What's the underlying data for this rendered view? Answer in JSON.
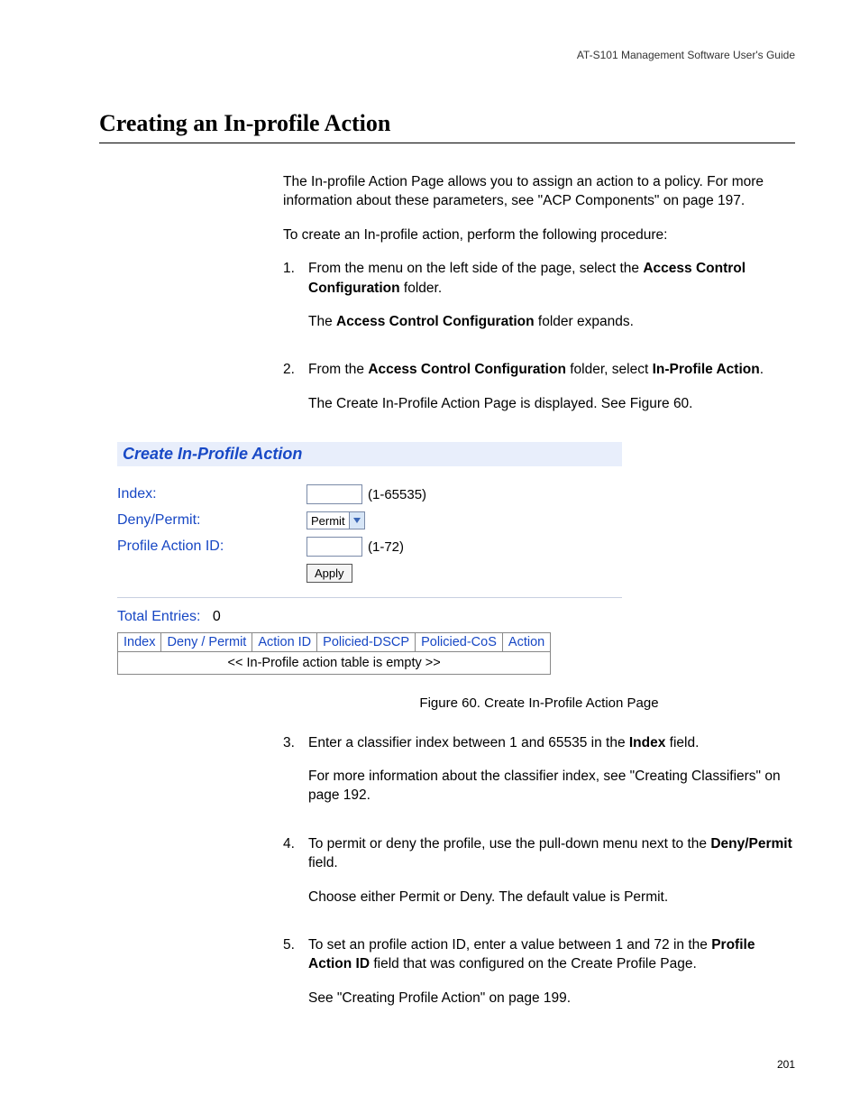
{
  "running_header": "AT-S101 Management Software User's Guide",
  "page_title": "Creating an In-profile Action",
  "intro_paragraph_parts": {
    "p1": "The In-profile Action Page allows you to assign an action to a policy. For more information about these parameters, see \"ACP Components\" on page 197."
  },
  "lead_in": "To create an In-profile action, perform the following procedure:",
  "steps": {
    "s1": {
      "num": "1.",
      "line1_pre": "From the menu on the left side of the page, select the ",
      "line1_b1": "Access Control Configuration",
      "line1_post": " folder.",
      "line2_pre": "The ",
      "line2_b": "Access Control Configuration",
      "line2_post": " folder expands."
    },
    "s2": {
      "num": "2.",
      "line1_pre": "From the ",
      "line1_b1": "Access Control Configuration",
      "line1_mid": " folder, select ",
      "line1_b2": "In-Profile Action",
      "line1_post": ".",
      "line2": "The Create In-Profile Action Page is displayed. See Figure 60."
    },
    "s3": {
      "num": "3.",
      "line1_pre": "Enter a classifier index between 1 and 65535 in the ",
      "line1_b": "Index",
      "line1_post": " field.",
      "line2": "For more information about the classifier index, see \"Creating Classifiers\" on page 192."
    },
    "s4": {
      "num": "4.",
      "line1_pre": "To permit or deny the profile, use the pull-down menu next to the ",
      "line1_b": "Deny/Permit",
      "line1_post": " field.",
      "line2": "Choose either Permit or Deny. The default value is Permit."
    },
    "s5": {
      "num": "5.",
      "line1_pre": "To set an profile action ID, enter a value between 1 and 72 in the ",
      "line1_b": "Profile Action ID",
      "line1_post": " field that was configured on the Create Profile Page.",
      "line2": "See \"Creating Profile Action\" on page 199."
    }
  },
  "screenshot": {
    "title": "Create In-Profile Action",
    "labels": {
      "index": "Index:",
      "deny_permit": "Deny/Permit:",
      "profile_action_id": "Profile Action ID:"
    },
    "hints": {
      "index": "(1-65535)",
      "profile_action_id": "(1-72)"
    },
    "select_value": "Permit",
    "apply_label": "Apply",
    "total_entries_label": "Total Entries:",
    "total_entries_value": "0",
    "columns": [
      "Index",
      "Deny / Permit",
      "Action ID",
      "Policied-DSCP",
      "Policied-CoS",
      "Action"
    ],
    "empty_text": "<< In-Profile action table is empty >>"
  },
  "figure_caption": "Figure 60. Create In-Profile Action Page",
  "page_number": "201"
}
